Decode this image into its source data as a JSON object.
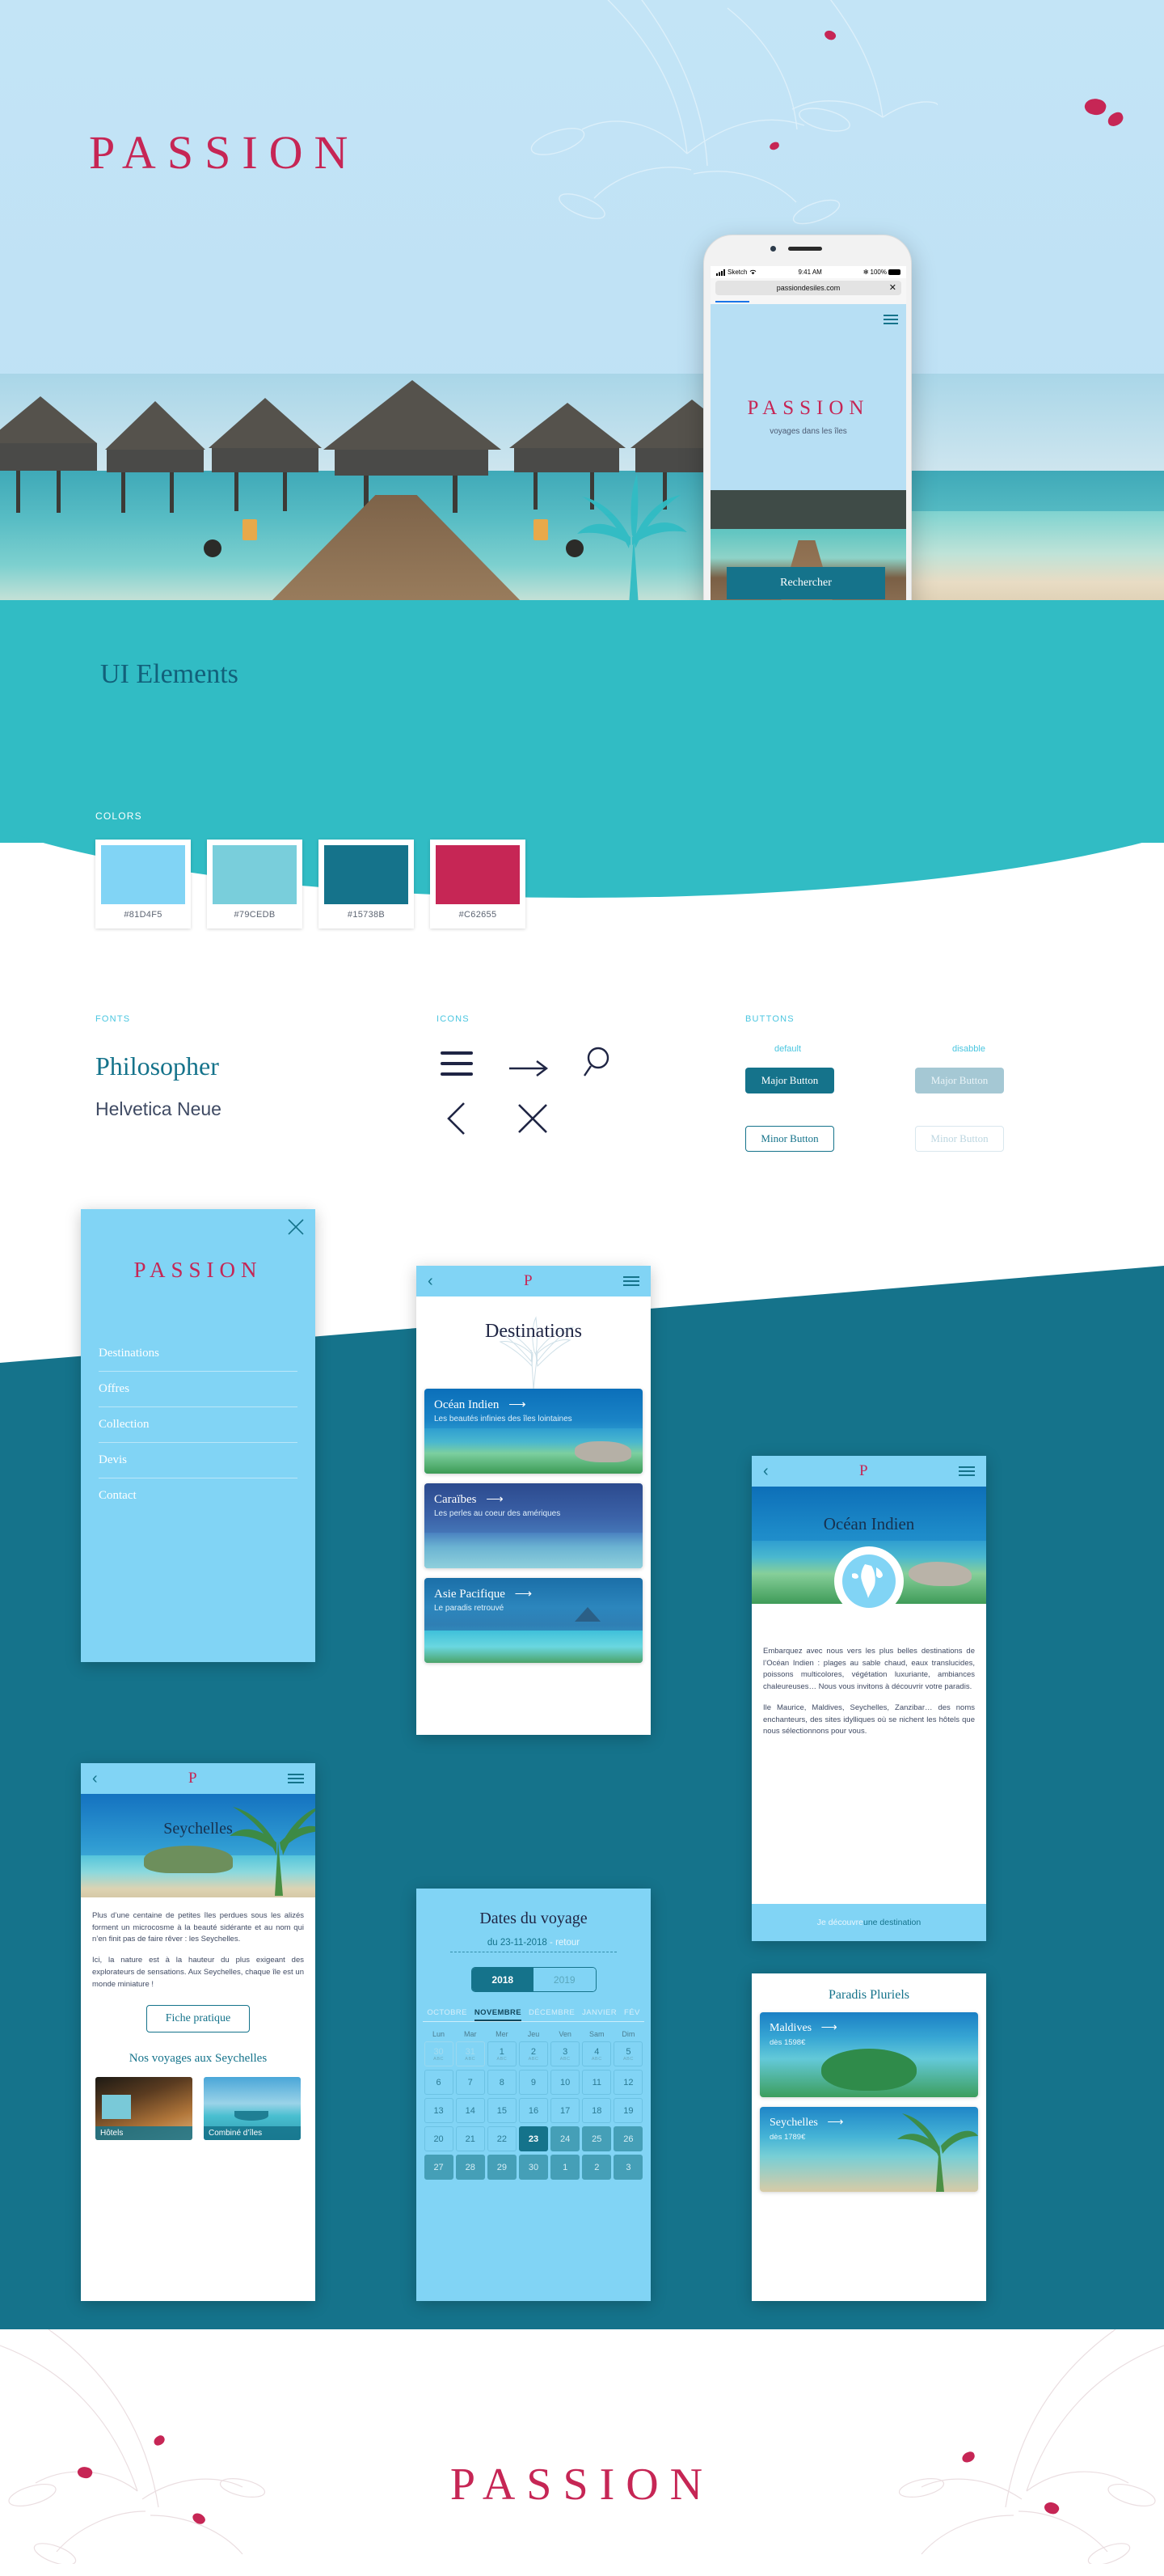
{
  "brand": {
    "name": "PASSION",
    "tagline": "voyages dans les îles",
    "mark": "P"
  },
  "hero": {
    "logo": "PASSION"
  },
  "ui_section": {
    "title": "UI Elements"
  },
  "colors": {
    "label": "COLORS",
    "swatches": [
      {
        "hex": "#81D4F5"
      },
      {
        "hex": "#79CEDB"
      },
      {
        "hex": "#15738B"
      },
      {
        "hex": "#C62655"
      }
    ]
  },
  "fonts": {
    "label": "FONTS",
    "primary": "Philosopher",
    "secondary": "Helvetica Neue"
  },
  "icons": {
    "label": "ICONS",
    "items": [
      "burger-icon",
      "arrow-right-icon",
      "search-icon",
      "chevron-left-icon",
      "close-icon"
    ]
  },
  "buttons": {
    "label": "BUTTONS",
    "state_default": "default",
    "state_disabled": "disabble",
    "major": "Major Button",
    "minor": "Minor Button"
  },
  "phone": {
    "status": {
      "carrier": "Sketch",
      "time": "9:41 AM",
      "battery": "100%"
    },
    "url": "passiondesiles.com",
    "logo": "PASSION",
    "tagline": "voyages dans les îles",
    "search_button": "Rechercher"
  },
  "menu_screen": {
    "logo": "PASSION",
    "items": [
      {
        "label": "Destinations"
      },
      {
        "label": "Offres"
      },
      {
        "label": "Collection"
      },
      {
        "label": "Devis"
      },
      {
        "label": "Contact"
      }
    ]
  },
  "destinations_screen": {
    "title": "Destinations",
    "cards": [
      {
        "label": "Océan Indien",
        "sub": "Les beautés infinies des îles lointaines"
      },
      {
        "label": "Caraïbes",
        "sub": "Les perles au coeur des amériques"
      },
      {
        "label": "Asie Pacifique",
        "sub": "Le paradis retrouvé"
      }
    ],
    "arrow": "⟶"
  },
  "ocean_screen": {
    "title": "Océan Indien",
    "paragraph1": "Embarquez avec nous vers les plus belles destinations de l’Océan Indien : plages au sable chaud, eaux translucides, poissons multicolores, végétation luxuriante, ambiances chaleureuses… Nous vous invitons à découvrir votre paradis.",
    "paragraph2": "Ile Maurice, Maldives, Seychelles, Zanzibar… des noms enchanteurs, des sites idylliques où se nichent les hôtels que nous sélectionnons pour vous.",
    "cta_prefix": "Je découvre ",
    "cta_link": "une destination"
  },
  "seychelles_screen": {
    "title": "Seychelles",
    "paragraph1": "Plus d’une centaine de petites îles perdues sous les alizés forment un microcosme à la beauté sidérante et au nom qui n’en finit pas de faire rêver : les Seychelles.",
    "paragraph2": "Ici, la nature est à la hauteur du plus exigeant des explorateurs de sensations. Aux Seychelles, chaque île est un monde miniature !",
    "button": "Fiche pratique",
    "subtitle": "Nos voyages aux Seychelles",
    "thumbs": [
      {
        "caption": "Hôtels"
      },
      {
        "caption": "Combiné d’îles"
      }
    ]
  },
  "dates_screen": {
    "title": "Dates du voyage",
    "range_prefix": "du ",
    "range_start": "23-11-2018",
    "range_sep": " - ",
    "range_end": "retour",
    "years": [
      {
        "label": "2018",
        "active": true
      },
      {
        "label": "2019",
        "active": false
      }
    ],
    "months": [
      "OCTOBRE",
      "NOVEMBRE",
      "DÉCEMBRE",
      "JANVIER",
      "FÉV"
    ],
    "active_month": "NOVEMBRE",
    "dow": [
      "Lun",
      "Mar",
      "Mer",
      "Jeu",
      "Ven",
      "Sam",
      "Dim"
    ],
    "sublabel": "ABC",
    "weeks": [
      [
        {
          "d": "30",
          "state": "dim",
          "sub": true
        },
        {
          "d": "31",
          "state": "dim",
          "sub": true
        },
        {
          "d": "1",
          "state": "on",
          "sub": true
        },
        {
          "d": "2",
          "state": "on",
          "sub": true
        },
        {
          "d": "3",
          "state": "on",
          "sub": true
        },
        {
          "d": "4",
          "state": "on",
          "sub": true
        },
        {
          "d": "5",
          "state": "on",
          "sub": true
        }
      ],
      [
        {
          "d": "6",
          "state": "on"
        },
        {
          "d": "7",
          "state": "on"
        },
        {
          "d": "8",
          "state": "on"
        },
        {
          "d": "9",
          "state": "on"
        },
        {
          "d": "10",
          "state": "on"
        },
        {
          "d": "11",
          "state": "on"
        },
        {
          "d": "12",
          "state": "on"
        }
      ],
      [
        {
          "d": "13",
          "state": "on"
        },
        {
          "d": "14",
          "state": "on"
        },
        {
          "d": "15",
          "state": "on"
        },
        {
          "d": "16",
          "state": "on"
        },
        {
          "d": "17",
          "state": "on"
        },
        {
          "d": "18",
          "state": "on"
        },
        {
          "d": "19",
          "state": "on"
        }
      ],
      [
        {
          "d": "20",
          "state": "on"
        },
        {
          "d": "21",
          "state": "on"
        },
        {
          "d": "22",
          "state": "on"
        },
        {
          "d": "23",
          "state": "sel"
        },
        {
          "d": "24",
          "state": "range"
        },
        {
          "d": "25",
          "state": "range"
        },
        {
          "d": "26",
          "state": "range"
        }
      ],
      [
        {
          "d": "27",
          "state": "range"
        },
        {
          "d": "28",
          "state": "range"
        },
        {
          "d": "29",
          "state": "range"
        },
        {
          "d": "30",
          "state": "range"
        },
        {
          "d": "1",
          "state": "range"
        },
        {
          "d": "2",
          "state": "range"
        },
        {
          "d": "3",
          "state": "range"
        }
      ]
    ]
  },
  "offers_screen": {
    "title": "Paradis Pluriels",
    "cards": [
      {
        "label": "Maldives",
        "price": "dès 1598€"
      },
      {
        "label": "Seychelles",
        "price": "dès 1789€"
      }
    ],
    "arrow": "⟶"
  },
  "footer": {
    "logo": "PASSION"
  }
}
